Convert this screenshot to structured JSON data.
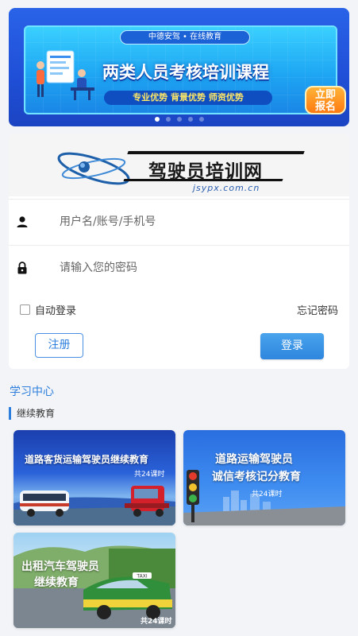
{
  "banner": {
    "top_pill": "中德安驾 • 在线教育",
    "title": "两类人员考核培训课程",
    "advantages": "专业优势  背景优势  师资优势",
    "cta_line1": "立即",
    "cta_line2": "报名",
    "dots": 5,
    "active_dot": 1
  },
  "logo": {
    "name": "驾驶员培训网",
    "domain": "jsypx.com.cn"
  },
  "login": {
    "username_placeholder": "用户名/账号/手机号",
    "password_placeholder": "请输入您的密码",
    "remember_label": "自动登录",
    "forgot_label": "忘记密码",
    "register_label": "注册",
    "login_label": "登录"
  },
  "study": {
    "section_title": "学习中心",
    "category": "继续教育",
    "courses": [
      {
        "title": "道路客货运输驾驶员继续教育",
        "hours": "共24课时"
      },
      {
        "title_line1": "道路运输驾驶员",
        "title_line2": "诚信考核记分教育",
        "hours": "共24课时"
      },
      {
        "title_line1": "出租汽车驾驶员",
        "title_line2": "继续教育",
        "hours": "共24课时",
        "taxi_sign": "TAXI"
      }
    ]
  },
  "colors": {
    "accent": "#2e7fdd",
    "banner_bg": "#2a63e8",
    "cta": "#ff8a1a"
  }
}
